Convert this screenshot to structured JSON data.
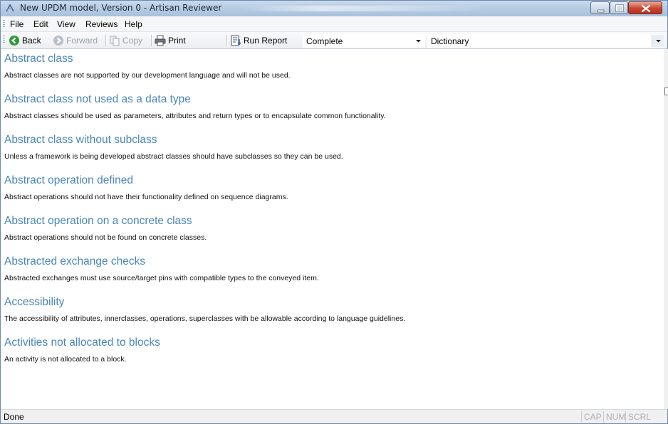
{
  "window": {
    "title": "New UPDM model, Version 0 - Artisan Reviewer"
  },
  "menu": {
    "items": [
      "File",
      "Edit",
      "View",
      "Reviews",
      "Help"
    ]
  },
  "toolbar": {
    "back": "Back",
    "forward": "Forward",
    "copy": "Copy",
    "print": "Print",
    "run_report": "Run Report",
    "status_select": "Complete",
    "category_select": "Dictionary"
  },
  "entries": [
    {
      "title": "Abstract class",
      "description": "Abstract classes are not supported by our development language and will not be used."
    },
    {
      "title": "Abstract class not used as a data type",
      "description": "Abstract classes should be used as parameters, attributes and return types or to encapsulate common functionality."
    },
    {
      "title": "Abstract class without subclass",
      "description": "Unless a framework is being developed abstract classes should have subclasses so they can be used."
    },
    {
      "title": "Abstract operation defined",
      "description": "Abstract operations should not have their functionality defined on sequence diagrams."
    },
    {
      "title": "Abstract operation on a concrete class",
      "description": "Abstract operations should not be found on concrete classes."
    },
    {
      "title": "Abstracted exchange checks",
      "description": "Abstracted exchanges must use source/target pins with compatible types to the conveyed item."
    },
    {
      "title": "Accessibility",
      "description": "The accessibility of attributes, innerclasses, operations, superclasses with be allowable according to language guidelines."
    },
    {
      "title": "Activities not allocated to blocks",
      "description": "An activity is not allocated to a block."
    }
  ],
  "statusbar": {
    "status": "Done",
    "indicators": [
      "CAP",
      "NUM",
      "SCRL"
    ]
  },
  "colors": {
    "heading": "#4a86b8",
    "titlebar": "#b7cde4",
    "close_button": "#c9442e"
  }
}
